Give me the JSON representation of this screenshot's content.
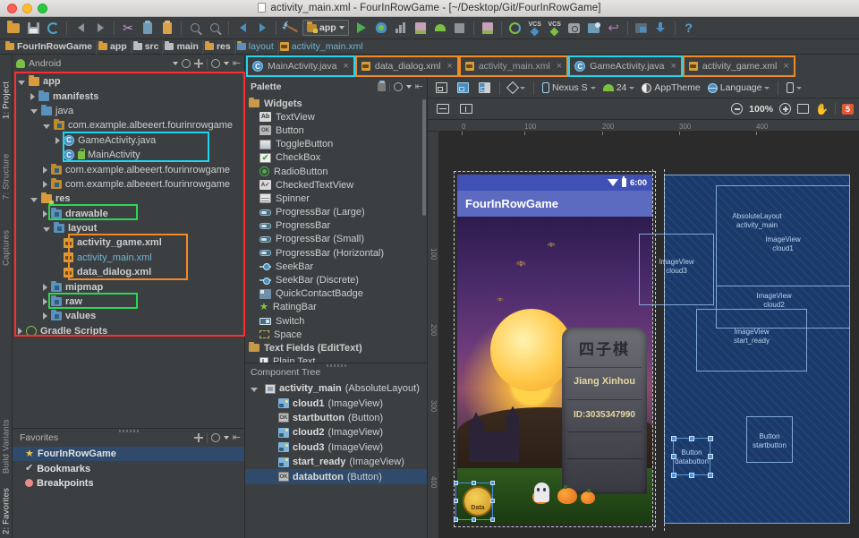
{
  "window": {
    "title": "activity_main.xml - FourInRowGame - [~/Desktop/Git/FourInRowGame]",
    "accent_cyan": "#22d3ee",
    "accent_orange": "#f08a24",
    "accent_red": "#ff2d2d",
    "accent_green": "#2fd655"
  },
  "toolbar": {
    "module_label": "app",
    "icons": [
      "open-folder-icon",
      "save-all-icon",
      "sync-project-icon",
      "undo-icon",
      "redo-icon",
      "cut-icon",
      "copy-icon",
      "paste-icon",
      "find-icon",
      "find-replace-icon",
      "back-icon",
      "forward-icon",
      "make-project-icon",
      "run-icon",
      "debug-icon",
      "profile-icon",
      "run-coverage-icon",
      "apply-changes-icon",
      "stop-icon",
      "android-profiler-icon",
      "sdk-manager-icon",
      "vcs-update-icon",
      "vcs-commit-icon",
      "safe-mode-icon",
      "avd-manager-icon",
      "revert-icon",
      "device-manager-icon",
      "sdk-download-icon",
      "help-icon"
    ]
  },
  "breadcrumb": {
    "items": [
      {
        "label": "FourInRowGame",
        "icon": "module-icon",
        "active": false
      },
      {
        "label": "app",
        "icon": "module-icon",
        "active": false
      },
      {
        "label": "src",
        "icon": "folder-icon",
        "active": false
      },
      {
        "label": "main",
        "icon": "folder-icon",
        "active": false
      },
      {
        "label": "res",
        "icon": "res-folder-icon",
        "active": false
      },
      {
        "label": "layout",
        "icon": "res-dir-icon",
        "active": false
      },
      {
        "label": "activity_main.xml",
        "icon": "xml-file-icon",
        "active": true
      }
    ]
  },
  "editor_tabs": [
    {
      "label": "MainActivity.java",
      "icon": "java-class-icon",
      "selected": false,
      "highlight": "cyan"
    },
    {
      "label": "data_dialog.xml",
      "icon": "xml-file-icon",
      "selected": false,
      "highlight": "orange"
    },
    {
      "label": "activity_main.xml",
      "icon": "xml-file-icon",
      "selected": true,
      "highlight": "orange"
    },
    {
      "label": "GameActivity.java",
      "icon": "java-class-icon",
      "selected": false,
      "highlight": "cyan"
    },
    {
      "label": "activity_game.xml",
      "icon": "xml-file-icon",
      "selected": false,
      "highlight": "orange"
    }
  ],
  "left_strips": {
    "top": [
      {
        "label": "1: Project",
        "active": true,
        "icon": "project-icon"
      },
      {
        "label": "7: Structure",
        "active": false,
        "icon": "structure-icon"
      },
      {
        "label": "Captures",
        "active": false,
        "icon": "captures-icon"
      }
    ],
    "bottom": [
      {
        "label": "Build Variants",
        "active": false,
        "icon": "build-variants-icon"
      },
      {
        "label": "2: Favorites",
        "active": true,
        "icon": "favorites-icon"
      }
    ]
  },
  "project_panel": {
    "title": "Android",
    "tools": [
      "collapse-all-icon",
      "locate-icon",
      "scroll-from-source-icon",
      "settings-gear-icon",
      "hide-icon"
    ],
    "tree": [
      {
        "depth": 0,
        "label": "app",
        "arrow": "open",
        "icon": "module-icon",
        "bold": true
      },
      {
        "depth": 1,
        "label": "manifests",
        "arrow": "closed",
        "icon": "folder-blue-icon",
        "bold": true
      },
      {
        "depth": 1,
        "label": "java",
        "arrow": "open",
        "icon": "folder-blue-icon",
        "bold": false
      },
      {
        "depth": 2,
        "label": "com.example.albeeert.fourinrowgame",
        "arrow": "open",
        "icon": "package-icon",
        "bold": false
      },
      {
        "depth": 3,
        "label": "GameActivity.java",
        "arrow": "closed",
        "icon": "java-class-icon",
        "bold": false
      },
      {
        "depth": 3,
        "label": "MainActivity",
        "arrow": "none",
        "icon": "java-class-lock-icon",
        "bold": false
      },
      {
        "depth": 2,
        "label": "com.example.albeeert.fourinrowgame",
        "arrow": "closed",
        "icon": "package-icon",
        "bold": false
      },
      {
        "depth": 2,
        "label": "com.example.albeeert.fourinrowgame",
        "arrow": "closed",
        "icon": "package-icon",
        "bold": false
      },
      {
        "depth": 1,
        "label": "res",
        "arrow": "open",
        "icon": "res-folder-icon",
        "bold": true
      },
      {
        "depth": 2,
        "label": "drawable",
        "arrow": "closed",
        "icon": "res-dir-icon",
        "bold": true
      },
      {
        "depth": 2,
        "label": "layout",
        "arrow": "open",
        "icon": "res-dir-icon",
        "bold": true
      },
      {
        "depth": 3,
        "label": "activity_game.xml",
        "arrow": "none",
        "icon": "xml-file-icon",
        "bold": true
      },
      {
        "depth": 3,
        "label": "activity_main.xml",
        "arrow": "none",
        "icon": "xml-file-icon",
        "bold": false,
        "color": "blue"
      },
      {
        "depth": 3,
        "label": "data_dialog.xml",
        "arrow": "none",
        "icon": "xml-file-icon",
        "bold": true
      },
      {
        "depth": 2,
        "label": "mipmap",
        "arrow": "closed",
        "icon": "res-dir-icon",
        "bold": true
      },
      {
        "depth": 2,
        "label": "raw",
        "arrow": "closed",
        "icon": "res-dir-icon",
        "bold": true
      },
      {
        "depth": 2,
        "label": "values",
        "arrow": "closed",
        "icon": "res-dir-icon",
        "bold": true
      },
      {
        "depth": 0,
        "label": "Gradle Scripts",
        "arrow": "closed",
        "icon": "gradle-icon",
        "bold": true
      }
    ]
  },
  "favorites_panel": {
    "title": "Favorites",
    "items": [
      {
        "label": "FourInRowGame",
        "icon": "star-icon",
        "selected": true
      },
      {
        "label": "Bookmarks",
        "icon": "check-icon",
        "selected": false
      },
      {
        "label": "Breakpoints",
        "icon": "breakpoint-icon",
        "selected": false
      }
    ]
  },
  "palette": {
    "title": "Palette",
    "items": [
      {
        "label": "Widgets",
        "kind": "group",
        "icon": "folder-icon"
      },
      {
        "label": "TextView",
        "kind": "item",
        "icon": "textview-icon"
      },
      {
        "label": "Button",
        "kind": "item",
        "icon": "button-icon"
      },
      {
        "label": "ToggleButton",
        "kind": "item",
        "icon": "togglebutton-icon"
      },
      {
        "label": "CheckBox",
        "kind": "item",
        "icon": "checkbox-icon"
      },
      {
        "label": "RadioButton",
        "kind": "item",
        "icon": "radiobutton-icon"
      },
      {
        "label": "CheckedTextView",
        "kind": "item",
        "icon": "checkedtextview-icon"
      },
      {
        "label": "Spinner",
        "kind": "item",
        "icon": "spinner-icon"
      },
      {
        "label": "ProgressBar (Large)",
        "kind": "item",
        "icon": "progressbar-icon"
      },
      {
        "label": "ProgressBar",
        "kind": "item",
        "icon": "progressbar-icon"
      },
      {
        "label": "ProgressBar (Small)",
        "kind": "item",
        "icon": "progressbar-icon"
      },
      {
        "label": "ProgressBar (Horizontal)",
        "kind": "item",
        "icon": "progressbar-icon"
      },
      {
        "label": "SeekBar",
        "kind": "item",
        "icon": "seekbar-icon"
      },
      {
        "label": "SeekBar (Discrete)",
        "kind": "item",
        "icon": "seekbar-icon"
      },
      {
        "label": "QuickContactBadge",
        "kind": "item",
        "icon": "quickcontactbadge-icon"
      },
      {
        "label": "RatingBar",
        "kind": "item",
        "icon": "ratingbar-icon"
      },
      {
        "label": "Switch",
        "kind": "item",
        "icon": "switch-icon"
      },
      {
        "label": "Space",
        "kind": "item",
        "icon": "space-icon"
      },
      {
        "label": "Text Fields (EditText)",
        "kind": "group",
        "icon": "folder-icon"
      },
      {
        "label": "Plain Text",
        "kind": "item",
        "icon": "plaintext-icon"
      }
    ]
  },
  "component_tree": {
    "title": "Component Tree",
    "items": [
      {
        "depth": 0,
        "name": "activity_main",
        "type": "(AbsoluteLayout)",
        "icon": "absolutelayout-icon",
        "arrow": "open",
        "selected": false
      },
      {
        "depth": 1,
        "name": "cloud1",
        "type": "(ImageView)",
        "icon": "imageview-icon",
        "arrow": "none",
        "selected": false
      },
      {
        "depth": 1,
        "name": "startbutton",
        "type": "(Button)",
        "icon": "button-icon",
        "arrow": "none",
        "selected": false
      },
      {
        "depth": 1,
        "name": "cloud2",
        "type": "(ImageView)",
        "icon": "imageview-icon",
        "arrow": "none",
        "selected": false
      },
      {
        "depth": 1,
        "name": "cloud3",
        "type": "(ImageView)",
        "icon": "imageview-icon",
        "arrow": "none",
        "selected": false
      },
      {
        "depth": 1,
        "name": "start_ready",
        "type": "(ImageView)",
        "icon": "imageview-icon",
        "arrow": "none",
        "selected": false
      },
      {
        "depth": 1,
        "name": "databutton",
        "type": "(Button)",
        "icon": "button-icon",
        "arrow": "none",
        "selected": true
      }
    ]
  },
  "design_toolbar": {
    "view_modes": [
      "design-mode-icon",
      "blueprint-mode-icon",
      "both-mode-icon"
    ],
    "orientation": "orientation-icon",
    "device": "Nexus S",
    "api_level": "24",
    "theme": "AppTheme",
    "locale": "Language",
    "device_class": "device-class-icon"
  },
  "zoom_toolbar": {
    "constraint_h": "expand-horizontal-icon",
    "constraint_v": "expand-vertical-icon",
    "zoom_out": "zoom-out-icon",
    "zoom_level": "100%",
    "zoom_in": "zoom-in-icon",
    "zoom_fit": "zoom-to-fit-icon",
    "pan": "pan-hand-icon",
    "error_count": "5"
  },
  "canvas": {
    "ruler_ticks": [
      "0",
      "100",
      "200",
      "300",
      "400"
    ],
    "ruler_ticks_v": [
      "100",
      "200",
      "300",
      "400"
    ]
  },
  "device_preview": {
    "status_time": "6:00",
    "app_title": "FourInRowGame",
    "tomb": {
      "game_name": "四子棋",
      "player": "Jiang Xinhou",
      "player_id": "ID:3035347990"
    },
    "data_button_label": "Data"
  },
  "blueprint": {
    "labels": [
      {
        "type": "AbsoluteLayout",
        "id": "activity_main"
      },
      {
        "type": "ImageView",
        "id": "cloud1"
      },
      {
        "type": "ImageView",
        "id": "cloud2"
      },
      {
        "type": "ImageView",
        "id": "cloud3"
      },
      {
        "type": "ImageView",
        "id": "start_ready"
      },
      {
        "type": "Button",
        "id": "startbutton"
      },
      {
        "type": "Button",
        "id": "databutton"
      }
    ]
  }
}
